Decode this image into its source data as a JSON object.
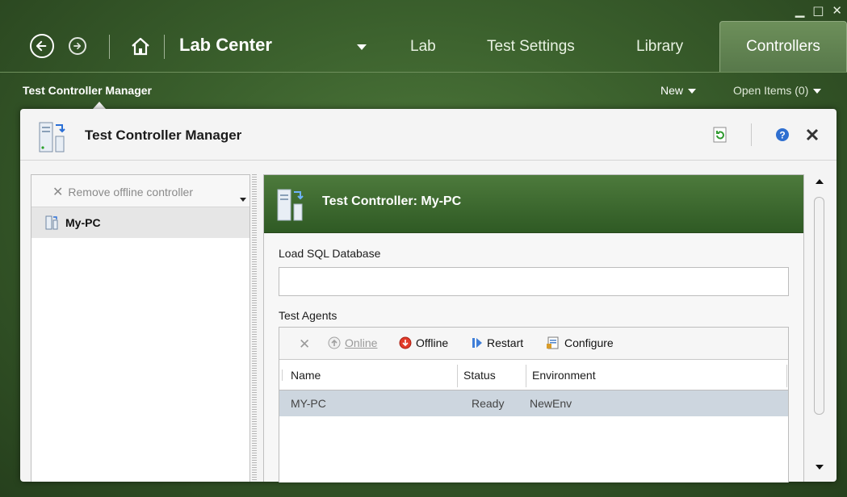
{
  "window": {
    "minimize": "‗",
    "maximize": "□",
    "close": "✕"
  },
  "header": {
    "app_title": "Lab Center",
    "tabs": [
      {
        "label": "Lab"
      },
      {
        "label": "Test Settings"
      },
      {
        "label": "Library"
      },
      {
        "label": "Controllers",
        "active": true
      }
    ]
  },
  "subbar": {
    "title": "Test Controller Manager",
    "new_label": "New",
    "open_items": "Open Items (0)"
  },
  "main": {
    "title": "Test Controller Manager",
    "left": {
      "remove_label": "Remove offline controller",
      "items": [
        {
          "label": "My-PC"
        }
      ]
    },
    "right": {
      "header_title": "Test Controller: My-PC",
      "load_sql_label": "Load SQL Database",
      "load_sql_value": "",
      "agents_label": "Test Agents",
      "toolbar": {
        "online": "Online",
        "offline": "Offline",
        "restart": "Restart",
        "configure": "Configure"
      },
      "columns": [
        "Name",
        "Status",
        "Environment"
      ],
      "rows": [
        {
          "name": "MY-PC",
          "status": "Ready",
          "environment": "NewEnv"
        }
      ]
    }
  },
  "colors": {
    "accent_green": "#3a5f2c",
    "header_green": "#3f6b31",
    "row_selected": "#cdd6df"
  }
}
